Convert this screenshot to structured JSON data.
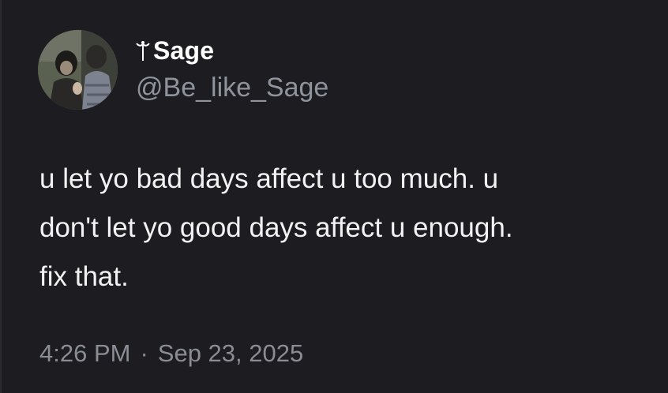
{
  "user": {
    "display_name": "Sage",
    "name_prefix_icon": "caduceus-symbol-icon",
    "handle": "@Be_like_Sage"
  },
  "tweet": {
    "lines": [
      "u let yo bad days affect u too much. u",
      "don't let yo good days affect u enough.",
      "fix that."
    ],
    "time": "4:26 PM",
    "separator": "·",
    "date": "Sep 23, 2025"
  },
  "colors": {
    "background": "#1c1c21",
    "text": "#f2f2f2",
    "muted": "#8f939b"
  }
}
